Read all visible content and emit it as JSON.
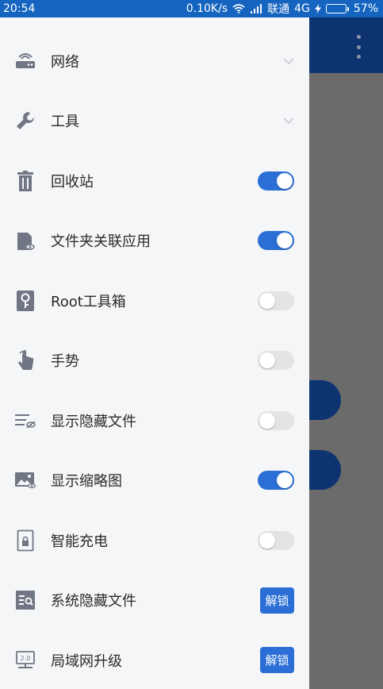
{
  "status_bar": {
    "time": "20:54",
    "speed": "0.10K/s",
    "carrier": "联通",
    "network": "4G",
    "battery": "57%",
    "battery_level": 0.57
  },
  "colors": {
    "status_bar": "#1565c0",
    "accent": "#2b6fd6",
    "drawer_bg": "#f5f6f8",
    "app_bar": "#0d3470"
  },
  "drawer": {
    "items": [
      {
        "label": "网络",
        "icon": "router-icon",
        "control": "chevron"
      },
      {
        "label": "工具",
        "icon": "wrench-icon",
        "control": "chevron"
      },
      {
        "label": "回收站",
        "icon": "trash-icon",
        "control": "toggle",
        "on": true
      },
      {
        "label": "文件夹关联应用",
        "icon": "folder-link-icon",
        "control": "toggle",
        "on": true
      },
      {
        "label": "Root工具箱",
        "icon": "root-key-icon",
        "control": "toggle",
        "on": false
      },
      {
        "label": "手势",
        "icon": "gesture-hand-icon",
        "control": "toggle",
        "on": false
      },
      {
        "label": "显示隐藏文件",
        "icon": "hidden-files-icon",
        "control": "toggle",
        "on": false
      },
      {
        "label": "显示缩略图",
        "icon": "thumbnail-icon",
        "control": "toggle",
        "on": true
      },
      {
        "label": "智能充电",
        "icon": "smart-charge-icon",
        "control": "toggle",
        "on": false
      },
      {
        "label": "系统隐藏文件",
        "icon": "system-hidden-icon",
        "control": "button",
        "button_label": "解锁"
      },
      {
        "label": "局域网升级",
        "icon": "lan-upgrade-icon",
        "control": "button",
        "button_label": "解锁"
      }
    ]
  }
}
